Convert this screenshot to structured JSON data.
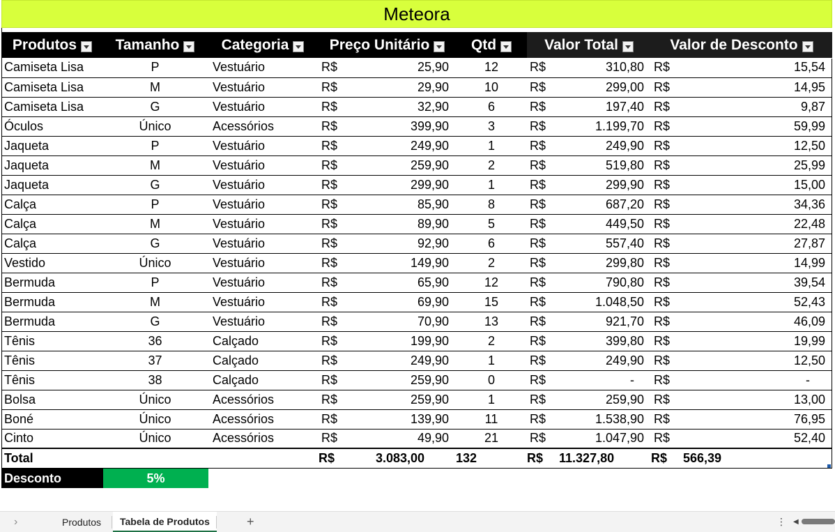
{
  "sheet_title": "Meteora",
  "columns": [
    "Produtos",
    "Tamanho",
    "Categoria",
    "Preço Unitário",
    "Qtd",
    "Valor Total",
    "Valor de Desconto"
  ],
  "currency": "R$",
  "rows": [
    {
      "produto": "Camiseta Lisa",
      "tamanho": "P",
      "categoria": "Vestuário",
      "preco": "25,90",
      "qtd": "12",
      "total": "310,80",
      "desconto": "15,54"
    },
    {
      "produto": "Camiseta Lisa",
      "tamanho": "M",
      "categoria": "Vestuário",
      "preco": "29,90",
      "qtd": "10",
      "total": "299,00",
      "desconto": "14,95"
    },
    {
      "produto": "Camiseta Lisa",
      "tamanho": "G",
      "categoria": "Vestuário",
      "preco": "32,90",
      "qtd": "6",
      "total": "197,40",
      "desconto": "9,87"
    },
    {
      "produto": "Óculos",
      "tamanho": "Único",
      "categoria": "Acessórios",
      "preco": "399,90",
      "qtd": "3",
      "total": "1.199,70",
      "desconto": "59,99"
    },
    {
      "produto": "Jaqueta",
      "tamanho": "P",
      "categoria": "Vestuário",
      "preco": "249,90",
      "qtd": "1",
      "total": "249,90",
      "desconto": "12,50"
    },
    {
      "produto": "Jaqueta",
      "tamanho": "M",
      "categoria": "Vestuário",
      "preco": "259,90",
      "qtd": "2",
      "total": "519,80",
      "desconto": "25,99"
    },
    {
      "produto": "Jaqueta",
      "tamanho": "G",
      "categoria": "Vestuário",
      "preco": "299,90",
      "qtd": "1",
      "total": "299,90",
      "desconto": "15,00"
    },
    {
      "produto": "Calça",
      "tamanho": "P",
      "categoria": "Vestuário",
      "preco": "85,90",
      "qtd": "8",
      "total": "687,20",
      "desconto": "34,36"
    },
    {
      "produto": "Calça",
      "tamanho": "M",
      "categoria": "Vestuário",
      "preco": "89,90",
      "qtd": "5",
      "total": "449,50",
      "desconto": "22,48"
    },
    {
      "produto": "Calça",
      "tamanho": "G",
      "categoria": "Vestuário",
      "preco": "92,90",
      "qtd": "6",
      "total": "557,40",
      "desconto": "27,87"
    },
    {
      "produto": "Vestido",
      "tamanho": "Único",
      "categoria": "Vestuário",
      "preco": "149,90",
      "qtd": "2",
      "total": "299,80",
      "desconto": "14,99"
    },
    {
      "produto": "Bermuda",
      "tamanho": "P",
      "categoria": "Vestuário",
      "preco": "65,90",
      "qtd": "12",
      "total": "790,80",
      "desconto": "39,54"
    },
    {
      "produto": "Bermuda",
      "tamanho": "M",
      "categoria": "Vestuário",
      "preco": "69,90",
      "qtd": "15",
      "total": "1.048,50",
      "desconto": "52,43"
    },
    {
      "produto": "Bermuda",
      "tamanho": "G",
      "categoria": "Vestuário",
      "preco": "70,90",
      "qtd": "13",
      "total": "921,70",
      "desconto": "46,09"
    },
    {
      "produto": "Tênis",
      "tamanho": "36",
      "categoria": "Calçado",
      "preco": "199,90",
      "qtd": "2",
      "total": "399,80",
      "desconto": "19,99"
    },
    {
      "produto": "Tênis",
      "tamanho": "37",
      "categoria": "Calçado",
      "preco": "249,90",
      "qtd": "1",
      "total": "249,90",
      "desconto": "12,50"
    },
    {
      "produto": "Tênis",
      "tamanho": "38",
      "categoria": "Calçado",
      "preco": "259,90",
      "qtd": "0",
      "total": "-",
      "desconto": "-"
    },
    {
      "produto": "Bolsa",
      "tamanho": "Único",
      "categoria": "Acessórios",
      "preco": "259,90",
      "qtd": "1",
      "total": "259,90",
      "desconto": "13,00"
    },
    {
      "produto": "Boné",
      "tamanho": "Único",
      "categoria": "Acessórios",
      "preco": "139,90",
      "qtd": "11",
      "total": "1.538,90",
      "desconto": "76,95"
    },
    {
      "produto": "Cinto",
      "tamanho": "Único",
      "categoria": "Acessórios",
      "preco": "49,90",
      "qtd": "21",
      "total": "1.047,90",
      "desconto": "52,40"
    }
  ],
  "totals": {
    "label": "Total",
    "preco": "3.083,00",
    "qtd": "132",
    "total": "11.327,80",
    "desconto": "566,39"
  },
  "discount": {
    "label": "Desconto",
    "value": "5%"
  },
  "sheet_tabs": [
    "Produtos",
    "Tabela de Produtos"
  ],
  "active_tab": "Tabela de Produtos",
  "icons": {
    "nav_prev": "chevron-right-icon",
    "add_sheet": "plus-icon",
    "more": "vertical-ellipsis-icon"
  },
  "colors": {
    "title_bg": "#d8ff3c",
    "header_bg": "#000000",
    "discount_bg": "#00b050"
  }
}
